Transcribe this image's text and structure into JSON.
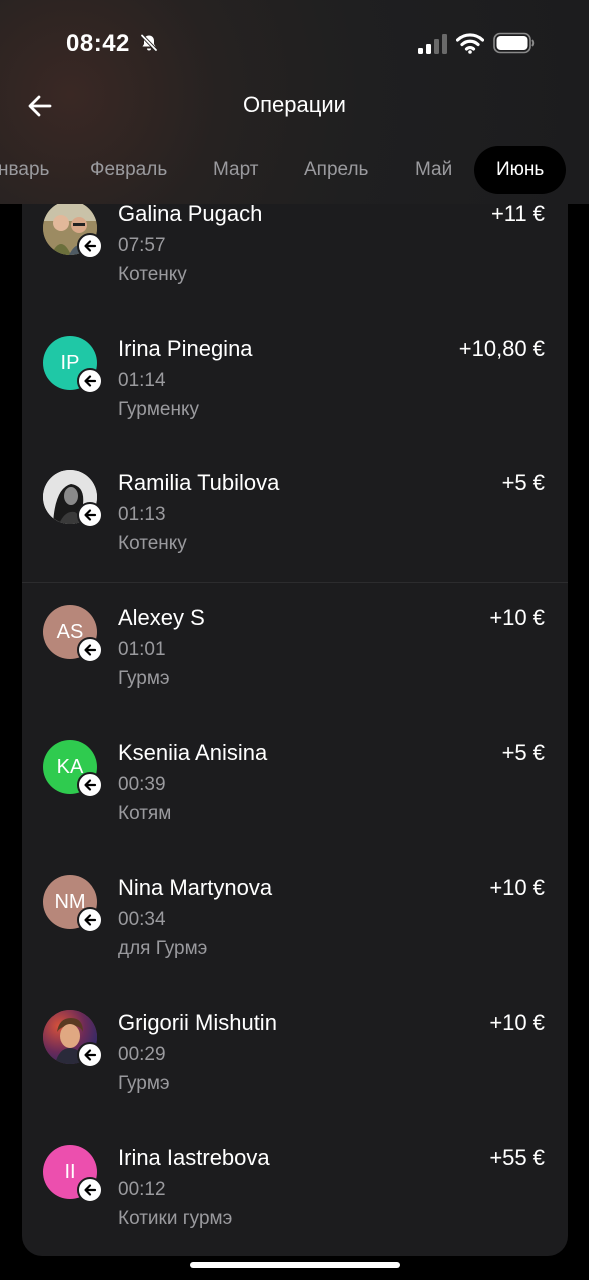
{
  "status_bar": {
    "time": "08:42",
    "icons": [
      "bell-slash-icon",
      "cellular-signal-icon",
      "wifi-icon",
      "battery-icon"
    ]
  },
  "header": {
    "title": "Операции",
    "back_icon": "arrow-left-icon"
  },
  "months": [
    {
      "label": "нварь",
      "active": false
    },
    {
      "label": "Февраль",
      "active": false
    },
    {
      "label": "Март",
      "active": false
    },
    {
      "label": "Апрель",
      "active": false
    },
    {
      "label": "Май",
      "active": false
    },
    {
      "label": "Июнь",
      "active": true
    }
  ],
  "transactions": [
    {
      "name": "Galina Pugach",
      "time": "07:57",
      "comment": "Котенку",
      "amount": "+11 €",
      "avatar": {
        "type": "photo",
        "initials": ""
      }
    },
    {
      "name": "Irina Pinegina",
      "time": "01:14",
      "comment": "Гурменку",
      "amount": "+10,80 €",
      "avatar": {
        "type": "initials",
        "initials": "IP",
        "color": "#1fc8a6"
      }
    },
    {
      "name": "Ramilia Tubilova",
      "time": "01:13",
      "comment": "Котенку",
      "amount": "+5 €",
      "avatar": {
        "type": "photo",
        "initials": ""
      }
    },
    {
      "name": "Alexey S",
      "time": "01:01",
      "comment": "Гурмэ",
      "amount": "+10 €",
      "avatar": {
        "type": "initials",
        "initials": "AS",
        "color": "#b7877a"
      }
    },
    {
      "name": "Kseniia Anisina",
      "time": "00:39",
      "comment": "Котям",
      "amount": "+5 €",
      "avatar": {
        "type": "initials",
        "initials": "KA",
        "color": "#2fcb4f"
      }
    },
    {
      "name": "Nina Martynova",
      "time": "00:34",
      "comment": "для Гурмэ",
      "amount": "+10 €",
      "avatar": {
        "type": "initials",
        "initials": "NM",
        "color": "#b7877a"
      }
    },
    {
      "name": "Grigorii Mishutin",
      "time": "00:29",
      "comment": "Гурмэ",
      "amount": "+10 €",
      "avatar": {
        "type": "photo",
        "initials": ""
      }
    },
    {
      "name": "Irina Iastrebova",
      "time": "00:12",
      "comment": "Котики гурмэ",
      "amount": "+55 €",
      "avatar": {
        "type": "initials",
        "initials": "II",
        "color": "#ec4fae"
      }
    }
  ],
  "badge_icon": "incoming-arrow-icon",
  "colors": {
    "background": "#000000",
    "card": "#1c1c1e",
    "secondary_text": "#9a9a9e"
  }
}
